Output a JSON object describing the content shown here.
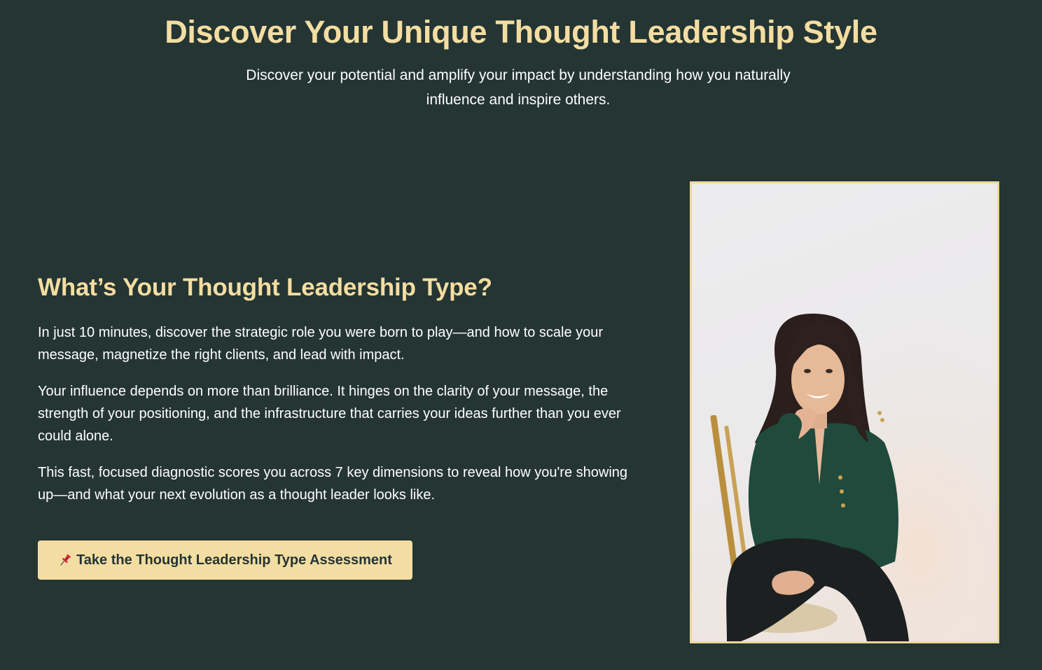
{
  "hero": {
    "title": "Discover Your Unique Thought Leadership Style",
    "subtitle": "Discover your potential and amplify your impact by understanding how you naturally influence and inspire others."
  },
  "section": {
    "heading": "What’s Your Thought Leadership Type?",
    "paragraphs": [
      "In just 10 minutes, discover the strategic role you were born to play—and how to scale your message, magnetize the right clients, and lead with impact.",
      "Your influence depends on more than brilliance. It hinges on the clarity of your message, the strength of your positioning, and the infrastructure that carries your ideas further than you ever could alone.",
      "This fast, focused diagnostic scores you across 7 key dimensions to reveal how you're showing up—and what your next evolution as a thought leader looks like."
    ],
    "cta": {
      "icon": "pushpin-icon",
      "label": "Take the Thought Leadership Type Assessment"
    }
  },
  "photo": {
    "subject": "portrait-photo"
  },
  "colors": {
    "background": "#243533",
    "accent": "#f4dda2",
    "text": "#ffffff",
    "button_text": "#243533"
  }
}
